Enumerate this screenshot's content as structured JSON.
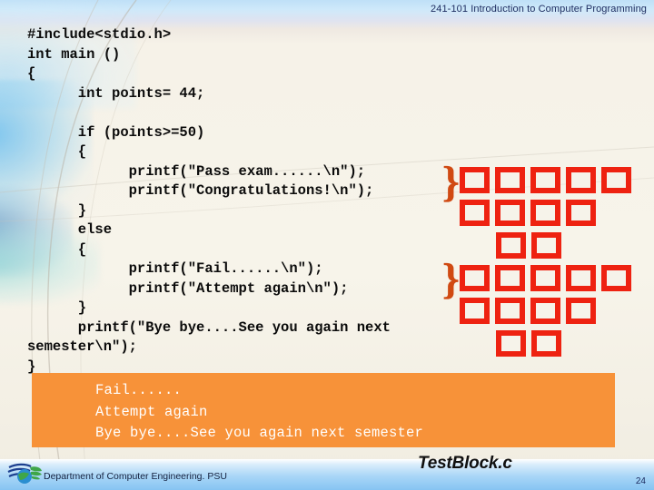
{
  "header": {
    "course_title": "241-101 Introduction to Computer Programming"
  },
  "code_block": {
    "language": "c",
    "lines": [
      "#include<stdio.h>",
      "int main ()",
      "{",
      "      int points= 44;",
      "",
      "      if (points>=50)",
      "      {",
      "            printf(\"Pass exam......\\n\");",
      "            printf(\"Congratulations!\\n\");",
      "      }",
      "      else",
      "      {",
      "            printf(\"Fail......\\n\");",
      "            printf(\"Attempt again\\n\");",
      "      }",
      "      printf(\"Bye bye....See you again next",
      "semester\\n\");",
      "}"
    ]
  },
  "annotations": {
    "brace_top": "}",
    "brace_bottom": "}",
    "glyph_note_rows": [
      {
        "indent": 0,
        "count": 5
      },
      {
        "indent": 0,
        "count": 4
      },
      {
        "indent": 1,
        "count": 2
      },
      {
        "indent": 0,
        "count": 5
      },
      {
        "indent": 0,
        "count": 4
      },
      {
        "indent": 1,
        "count": 2
      }
    ],
    "brace_color": "#d14a12",
    "glyph_box_color": "#ee2211"
  },
  "console": {
    "background_color": "#f79239",
    "lines": [
      "Fail......",
      "Attempt again",
      "Bye bye....See you again next semester"
    ]
  },
  "footer": {
    "department": "Department of Computer Engineering. PSU",
    "logo_name": "psu-globe-logo",
    "filename": "TestBlock.c",
    "slide_number": "24"
  }
}
